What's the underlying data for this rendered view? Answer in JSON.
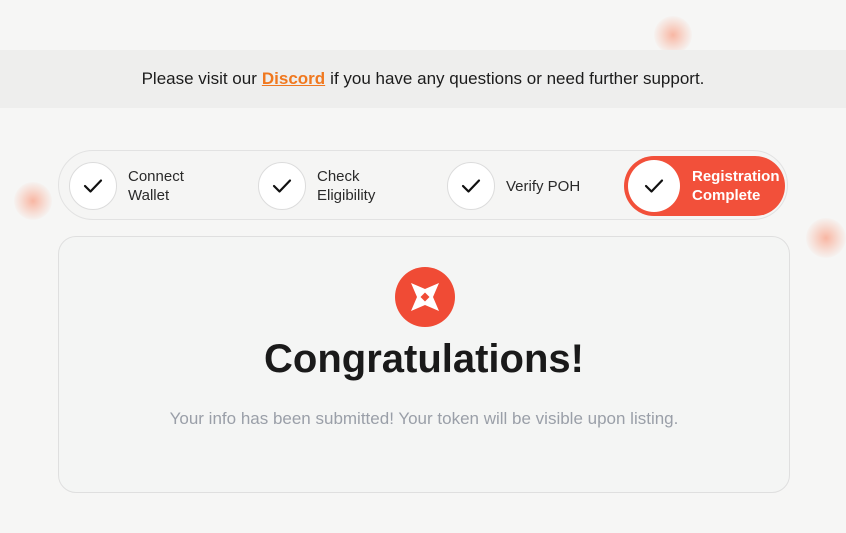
{
  "banner": {
    "prefix": "Please visit our",
    "link_label": "Discord",
    "suffix": "if you have any questions or need further support."
  },
  "steps": [
    {
      "label": "Connect\nWallet",
      "status": "done"
    },
    {
      "label": "Check\nEligibility",
      "status": "done"
    },
    {
      "label": "Verify POH",
      "status": "done"
    },
    {
      "label": "Registration\nComplete",
      "status": "active"
    }
  ],
  "card": {
    "logo_icon": "shuriken-icon",
    "title": "Congratulations!",
    "message": "Your info has been submitted! Your token will be visible upon listing."
  },
  "colors": {
    "accent": "#f2503a",
    "link": "#f0781f",
    "muted_text": "#9a9fa8"
  }
}
